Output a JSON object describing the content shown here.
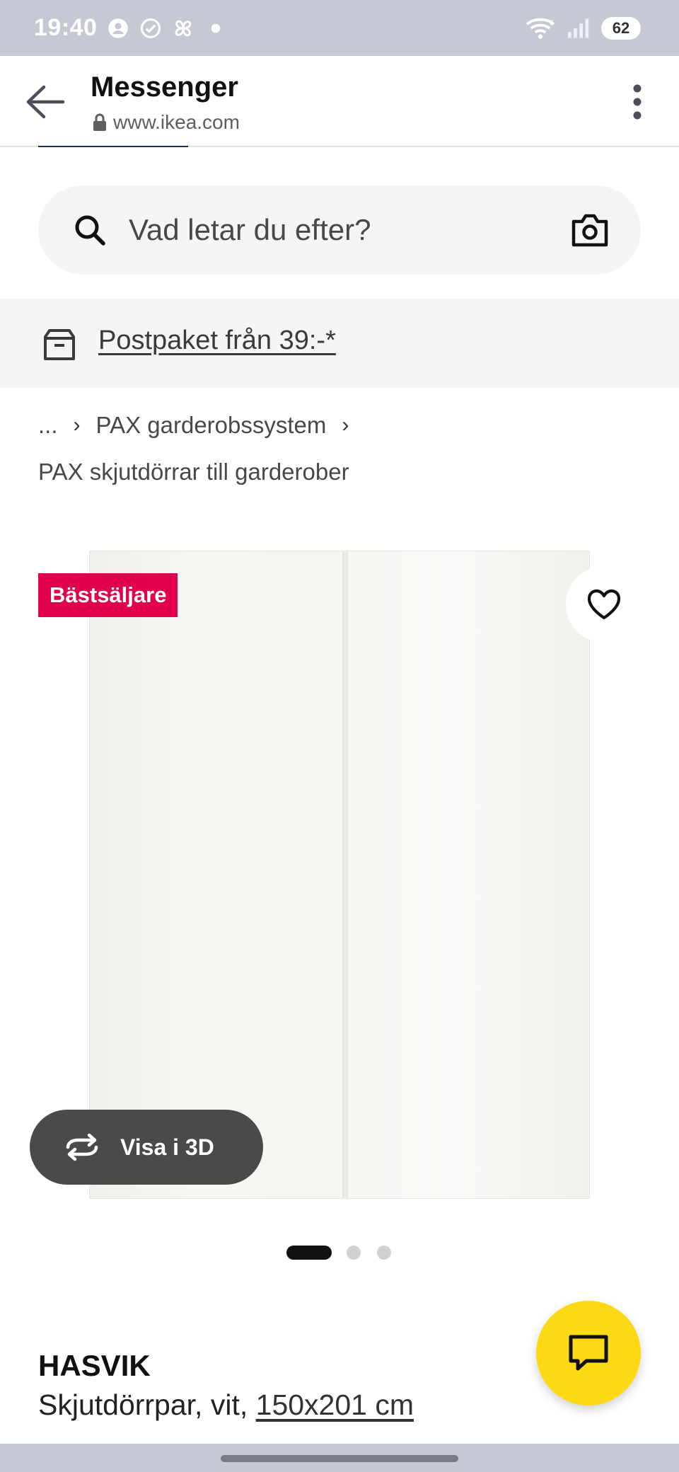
{
  "status_bar": {
    "time": "19:40",
    "battery": "62",
    "icons": [
      "account-circle-icon",
      "check-circle-icon",
      "pinwheel-icon",
      "dot-icon",
      "wifi-icon",
      "signal-icon"
    ]
  },
  "app_bar": {
    "title": "Messenger",
    "url": "www.ikea.com"
  },
  "search": {
    "placeholder": "Vad letar du efter?"
  },
  "promo": {
    "text": "Postpaket från 39:-*"
  },
  "breadcrumb": {
    "ellipsis": "...",
    "items": [
      "PAX garderobssystem"
    ],
    "current": "PAX skjutdörrar till garderober"
  },
  "product_gallery": {
    "badge": "Bästsäljare",
    "view_3d_label": "Visa i 3D",
    "dots_total": 3,
    "active_dot": 1
  },
  "product": {
    "name": "HASVIK",
    "description": "Skjutdörrpar, vit,",
    "size": "150x201 cm"
  },
  "colors": {
    "status_bar": "#c6c9d3",
    "badge": "#e0004d",
    "chat_fab": "#fbd914",
    "search_bg": "#f5f5f5"
  }
}
